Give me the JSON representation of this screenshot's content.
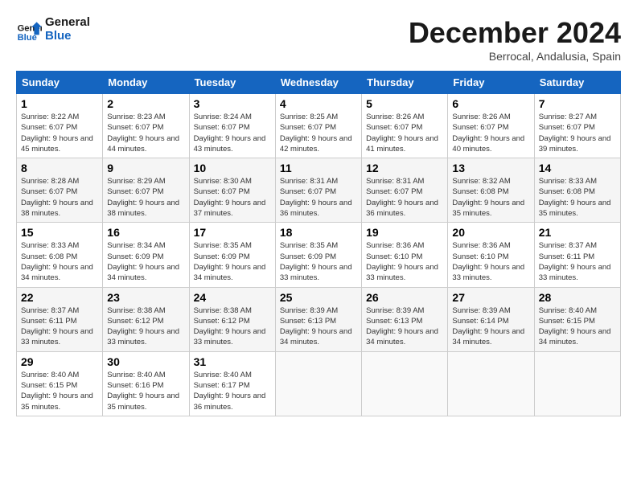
{
  "logo": {
    "line1": "General",
    "line2": "Blue"
  },
  "title": "December 2024",
  "subtitle": "Berrocal, Andalusia, Spain",
  "weekdays": [
    "Sunday",
    "Monday",
    "Tuesday",
    "Wednesday",
    "Thursday",
    "Friday",
    "Saturday"
  ],
  "weeks": [
    [
      {
        "day": "1",
        "sunrise": "Sunrise: 8:22 AM",
        "sunset": "Sunset: 6:07 PM",
        "daylight": "Daylight: 9 hours and 45 minutes."
      },
      {
        "day": "2",
        "sunrise": "Sunrise: 8:23 AM",
        "sunset": "Sunset: 6:07 PM",
        "daylight": "Daylight: 9 hours and 44 minutes."
      },
      {
        "day": "3",
        "sunrise": "Sunrise: 8:24 AM",
        "sunset": "Sunset: 6:07 PM",
        "daylight": "Daylight: 9 hours and 43 minutes."
      },
      {
        "day": "4",
        "sunrise": "Sunrise: 8:25 AM",
        "sunset": "Sunset: 6:07 PM",
        "daylight": "Daylight: 9 hours and 42 minutes."
      },
      {
        "day": "5",
        "sunrise": "Sunrise: 8:26 AM",
        "sunset": "Sunset: 6:07 PM",
        "daylight": "Daylight: 9 hours and 41 minutes."
      },
      {
        "day": "6",
        "sunrise": "Sunrise: 8:26 AM",
        "sunset": "Sunset: 6:07 PM",
        "daylight": "Daylight: 9 hours and 40 minutes."
      },
      {
        "day": "7",
        "sunrise": "Sunrise: 8:27 AM",
        "sunset": "Sunset: 6:07 PM",
        "daylight": "Daylight: 9 hours and 39 minutes."
      }
    ],
    [
      {
        "day": "8",
        "sunrise": "Sunrise: 8:28 AM",
        "sunset": "Sunset: 6:07 PM",
        "daylight": "Daylight: 9 hours and 38 minutes."
      },
      {
        "day": "9",
        "sunrise": "Sunrise: 8:29 AM",
        "sunset": "Sunset: 6:07 PM",
        "daylight": "Daylight: 9 hours and 38 minutes."
      },
      {
        "day": "10",
        "sunrise": "Sunrise: 8:30 AM",
        "sunset": "Sunset: 6:07 PM",
        "daylight": "Daylight: 9 hours and 37 minutes."
      },
      {
        "day": "11",
        "sunrise": "Sunrise: 8:31 AM",
        "sunset": "Sunset: 6:07 PM",
        "daylight": "Daylight: 9 hours and 36 minutes."
      },
      {
        "day": "12",
        "sunrise": "Sunrise: 8:31 AM",
        "sunset": "Sunset: 6:07 PM",
        "daylight": "Daylight: 9 hours and 36 minutes."
      },
      {
        "day": "13",
        "sunrise": "Sunrise: 8:32 AM",
        "sunset": "Sunset: 6:08 PM",
        "daylight": "Daylight: 9 hours and 35 minutes."
      },
      {
        "day": "14",
        "sunrise": "Sunrise: 8:33 AM",
        "sunset": "Sunset: 6:08 PM",
        "daylight": "Daylight: 9 hours and 35 minutes."
      }
    ],
    [
      {
        "day": "15",
        "sunrise": "Sunrise: 8:33 AM",
        "sunset": "Sunset: 6:08 PM",
        "daylight": "Daylight: 9 hours and 34 minutes."
      },
      {
        "day": "16",
        "sunrise": "Sunrise: 8:34 AM",
        "sunset": "Sunset: 6:09 PM",
        "daylight": "Daylight: 9 hours and 34 minutes."
      },
      {
        "day": "17",
        "sunrise": "Sunrise: 8:35 AM",
        "sunset": "Sunset: 6:09 PM",
        "daylight": "Daylight: 9 hours and 34 minutes."
      },
      {
        "day": "18",
        "sunrise": "Sunrise: 8:35 AM",
        "sunset": "Sunset: 6:09 PM",
        "daylight": "Daylight: 9 hours and 33 minutes."
      },
      {
        "day": "19",
        "sunrise": "Sunrise: 8:36 AM",
        "sunset": "Sunset: 6:10 PM",
        "daylight": "Daylight: 9 hours and 33 minutes."
      },
      {
        "day": "20",
        "sunrise": "Sunrise: 8:36 AM",
        "sunset": "Sunset: 6:10 PM",
        "daylight": "Daylight: 9 hours and 33 minutes."
      },
      {
        "day": "21",
        "sunrise": "Sunrise: 8:37 AM",
        "sunset": "Sunset: 6:11 PM",
        "daylight": "Daylight: 9 hours and 33 minutes."
      }
    ],
    [
      {
        "day": "22",
        "sunrise": "Sunrise: 8:37 AM",
        "sunset": "Sunset: 6:11 PM",
        "daylight": "Daylight: 9 hours and 33 minutes."
      },
      {
        "day": "23",
        "sunrise": "Sunrise: 8:38 AM",
        "sunset": "Sunset: 6:12 PM",
        "daylight": "Daylight: 9 hours and 33 minutes."
      },
      {
        "day": "24",
        "sunrise": "Sunrise: 8:38 AM",
        "sunset": "Sunset: 6:12 PM",
        "daylight": "Daylight: 9 hours and 33 minutes."
      },
      {
        "day": "25",
        "sunrise": "Sunrise: 8:39 AM",
        "sunset": "Sunset: 6:13 PM",
        "daylight": "Daylight: 9 hours and 34 minutes."
      },
      {
        "day": "26",
        "sunrise": "Sunrise: 8:39 AM",
        "sunset": "Sunset: 6:13 PM",
        "daylight": "Daylight: 9 hours and 34 minutes."
      },
      {
        "day": "27",
        "sunrise": "Sunrise: 8:39 AM",
        "sunset": "Sunset: 6:14 PM",
        "daylight": "Daylight: 9 hours and 34 minutes."
      },
      {
        "day": "28",
        "sunrise": "Sunrise: 8:40 AM",
        "sunset": "Sunset: 6:15 PM",
        "daylight": "Daylight: 9 hours and 34 minutes."
      }
    ],
    [
      {
        "day": "29",
        "sunrise": "Sunrise: 8:40 AM",
        "sunset": "Sunset: 6:15 PM",
        "daylight": "Daylight: 9 hours and 35 minutes."
      },
      {
        "day": "30",
        "sunrise": "Sunrise: 8:40 AM",
        "sunset": "Sunset: 6:16 PM",
        "daylight": "Daylight: 9 hours and 35 minutes."
      },
      {
        "day": "31",
        "sunrise": "Sunrise: 8:40 AM",
        "sunset": "Sunset: 6:17 PM",
        "daylight": "Daylight: 9 hours and 36 minutes."
      },
      null,
      null,
      null,
      null
    ]
  ]
}
